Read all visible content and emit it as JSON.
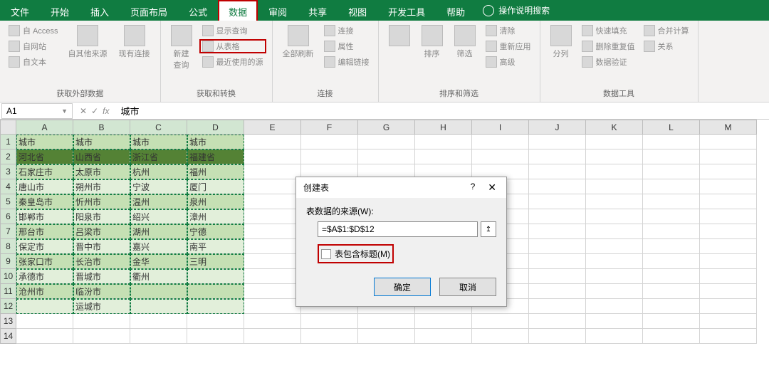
{
  "tabs": {
    "file": "文件",
    "home": "开始",
    "insert": "插入",
    "layout": "页面布局",
    "formula": "公式",
    "data": "数据",
    "review": "审阅",
    "share": "共享",
    "view": "视图",
    "developer": "开发工具",
    "help": "帮助",
    "search": "操作说明搜索"
  },
  "ribbon": {
    "ext_data": {
      "access": "自 Access",
      "web": "自网站",
      "text": "自文本",
      "other": "自其他来源",
      "existing": "现有连接",
      "label": "获取外部数据"
    },
    "get_transform": {
      "new_query": "新建\n查询",
      "show_query": "显示查询",
      "from_table": "从表格",
      "recent": "最近使用的源",
      "label": "获取和转换"
    },
    "connections": {
      "refresh_all": "全部刷新",
      "connect": "连接",
      "properties": "属性",
      "edit_links": "编辑链接",
      "label": "连接"
    },
    "sort_filter": {
      "sort": "排序",
      "filter": "筛选",
      "clear": "清除",
      "reapply": "重新应用",
      "advanced": "高级",
      "label": "排序和筛选"
    },
    "data_tools": {
      "text_to_cols": "分列",
      "flash_fill": "快速填充",
      "remove_dup": "删除重复值",
      "data_validation": "数据验证",
      "consolidate": "合并计算",
      "relationships": "关系",
      "label": "数据工具"
    }
  },
  "formula_bar": {
    "name_box": "A1",
    "value": "城市"
  },
  "columns": [
    "A",
    "B",
    "C",
    "D",
    "E",
    "F",
    "G",
    "H",
    "I",
    "J",
    "K",
    "L",
    "M"
  ],
  "rows": [
    {
      "n": "1",
      "c": [
        "城市",
        "城市",
        "城市",
        "城市"
      ]
    },
    {
      "n": "2",
      "c": [
        "河北省",
        "山西省",
        "浙江省",
        "福建省"
      ]
    },
    {
      "n": "3",
      "c": [
        "石家庄市",
        "太原市",
        "杭州",
        "福州"
      ]
    },
    {
      "n": "4",
      "c": [
        "唐山市",
        "朔州市",
        "宁波",
        "厦门"
      ]
    },
    {
      "n": "5",
      "c": [
        "秦皇岛市",
        "忻州市",
        "温州",
        "泉州"
      ]
    },
    {
      "n": "6",
      "c": [
        "邯郸市",
        "阳泉市",
        "绍兴",
        "漳州"
      ]
    },
    {
      "n": "7",
      "c": [
        "邢台市",
        "吕梁市",
        "湖州",
        "宁德"
      ]
    },
    {
      "n": "8",
      "c": [
        "保定市",
        "晋中市",
        "嘉兴",
        "南平"
      ]
    },
    {
      "n": "9",
      "c": [
        "张家口市",
        "长治市",
        "金华",
        "三明"
      ]
    },
    {
      "n": "10",
      "c": [
        "承德市",
        "晋城市",
        "衢州",
        ""
      ]
    },
    {
      "n": "11",
      "c": [
        "沧州市",
        "临汾市",
        "",
        ""
      ]
    },
    {
      "n": "12",
      "c": [
        "",
        "运城市",
        "",
        ""
      ]
    },
    {
      "n": "13",
      "c": [
        "",
        "",
        "",
        ""
      ]
    },
    {
      "n": "14",
      "c": [
        "",
        "",
        "",
        ""
      ]
    }
  ],
  "dialog": {
    "title": "创建表",
    "help": "?",
    "source_label": "表数据的来源(W):",
    "source_value": "=$A$1:$D$12",
    "checkbox_label": "表包含标题(M)",
    "ok": "确定",
    "cancel": "取消"
  }
}
